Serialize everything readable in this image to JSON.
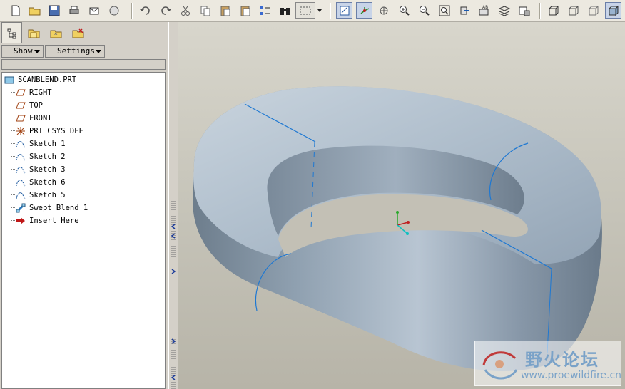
{
  "toolbar": {
    "icons": [
      "new-file-icon",
      "open-folder-icon",
      "save-icon",
      "print-icon",
      "send-email-icon",
      "email-attach-icon",
      "undo-icon",
      "redo-icon",
      "cut-icon",
      "copy-icon",
      "paste-icon",
      "paste-special-icon",
      "regenerate-icon",
      "find-icon",
      "select-box-icon",
      "dropdown-arrow-icon",
      "repaint-icon",
      "spin-center-icon",
      "orient-icon",
      "zoom-in-icon",
      "zoom-out-icon",
      "refit-icon",
      "view-orientation-icon",
      "saved-views-icon",
      "layers-icon",
      "view-manager-icon",
      "wireframe-icon",
      "hidden-line-icon",
      "no-hidden-icon",
      "shading-icon"
    ]
  },
  "panel": {
    "tabs": [
      "model-tree-tab",
      "folder-browser-tab",
      "favorites-tab",
      "connections-tab"
    ],
    "show_label": "Show",
    "settings_label": "Settings",
    "filter_value": ""
  },
  "tree": {
    "root": "SCANBLEND.PRT",
    "items": [
      {
        "label": "RIGHT",
        "icon": "datum-plane-icon"
      },
      {
        "label": "TOP",
        "icon": "datum-plane-icon"
      },
      {
        "label": "FRONT",
        "icon": "datum-plane-icon"
      },
      {
        "label": "PRT_CSYS_DEF",
        "icon": "coordinate-system-icon"
      },
      {
        "label": "Sketch 1",
        "icon": "sketch-icon"
      },
      {
        "label": "Sketch 2",
        "icon": "sketch-icon"
      },
      {
        "label": "Sketch 3",
        "icon": "sketch-icon"
      },
      {
        "label": "Sketch 6",
        "icon": "sketch-icon"
      },
      {
        "label": "Sketch 5",
        "icon": "sketch-icon"
      },
      {
        "label": "Swept Blend 1",
        "icon": "swept-blend-icon"
      },
      {
        "label": "Insert Here",
        "icon": "insert-arrow-icon"
      }
    ]
  },
  "viewport": {
    "model": "swept-blend-ring",
    "colors": {
      "shaded_body": "#a9b7c4",
      "edge": "#1e78d2",
      "background": "#c6c4b9"
    }
  },
  "watermark": {
    "title": "野火论坛",
    "url": "www.proewildfire.cn"
  }
}
